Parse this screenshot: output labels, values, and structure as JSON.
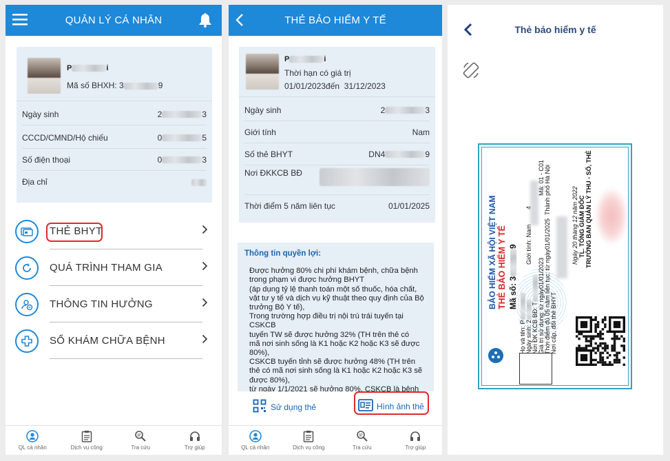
{
  "screen1": {
    "header_title": "QUẢN LÝ CÁ NHÂN",
    "profile": {
      "name_prefix": "P",
      "name_suffix": "i",
      "bhxh_label": "Mã số BHXH: 3",
      "bhxh_end": "9"
    },
    "fields": [
      {
        "label": "Ngày sinh",
        "value_start": "2",
        "value_end": "3"
      },
      {
        "label": "CCCD/CMND/Hộ chiếu",
        "value_start": "0",
        "value_end": "5"
      },
      {
        "label": "Số điện thoại",
        "value_start": "0",
        "value_end": "3"
      },
      {
        "label": "Địa chỉ",
        "value_start": "",
        "value_end": ""
      }
    ],
    "menu": [
      {
        "label": "THẺ BHYT",
        "icon": "card-icon"
      },
      {
        "label": "QUÁ TRÌNH THAM GIA",
        "icon": "refresh-icon"
      },
      {
        "label": "THÔNG TIN HƯỞNG",
        "icon": "user-info-icon"
      },
      {
        "label": "SỔ KHÁM CHỮA BỆNH",
        "icon": "medical-cross-icon"
      }
    ]
  },
  "tabs": [
    {
      "label": "QL cá nhân",
      "icon": "user-circle-icon"
    },
    {
      "label": "Dịch vụ công",
      "icon": "clipboard-icon"
    },
    {
      "label": "Tra cứu",
      "icon": "search-doc-icon"
    },
    {
      "label": "Trợ giúp",
      "icon": "headset-icon"
    }
  ],
  "screen2": {
    "header_title": "THẺ BẢO HIỂM Y TẾ",
    "profile": {
      "name_prefix": "P",
      "name_suffix": "i",
      "validity_label": "Thời hạn có giá trị",
      "validity_from": "01/01/2023đến",
      "validity_to": "31/12/2023"
    },
    "fields": [
      {
        "label": "Ngày sinh",
        "value_start": "2",
        "value_end": "3"
      },
      {
        "label": "Giới tính",
        "value_start": "",
        "value_end": "Nam"
      },
      {
        "label": "Số thẻ BHYT",
        "value_start": "DN4",
        "value_end": "9"
      },
      {
        "label": "Nơi ĐKKCB BĐ",
        "value_start": "",
        "value_end": ""
      },
      {
        "label": "Thời điểm 5 năm liên tục",
        "value_start": "",
        "value_end": "01/01/2025"
      }
    ],
    "benefit_title": "Thông tin quyền lợi:",
    "benefit_lines": [
      "Được hưởng 80% chi phí khám bệnh, chữa bệnh",
      "trong phạm vi được hưởng BHYT",
      "(áp dụng tỷ lệ thanh toán một số thuốc, hóa chất,",
      "vật tư y tế và dịch vụ kỹ thuật theo quy định của Bộ",
      "trưởng Bộ Y tế),",
      "Trong trường hợp điều trị nội trú trái tuyến tại CSKCB",
      "tuyến TW sẽ được hưởng 32% (TH trên thẻ có",
      "mã nơi sinh sống là K1 hoặc K2 hoặc K3 sẽ được",
      "80%),",
      "CSKCB tuyến tỉnh sẽ được hưởng 48% (TH trên",
      "thẻ có mã nơi sinh sống là K1 hoặc K2 hoặc K3 sẽ",
      "được 80%),",
      "từ ngày 1/1/2021 sẽ hưởng 80%. CSKCB là bệnh"
    ],
    "action_use": "Sử dụng thẻ",
    "action_image": "Hình ảnh  thẻ"
  },
  "screen3": {
    "title": "Thẻ bảo hiểm y tế",
    "card": {
      "org": "BẢO HIỂM XÃ HỘI VIỆT NAM",
      "title": "THẺ BẢO HIỂM Y TẾ",
      "code_label": "Mã số: 3",
      "code_end": "9",
      "name_label": "Họ và tên: P",
      "dob_label": "Ngày sinh: 2",
      "gender": "Giới tính: Nam",
      "kcb_label": "Nơi ĐK KCB BĐ: T",
      "validity": "Giá trị sử dụng: từ ngày01/01/2023",
      "five_years": "Thời điểm đủ 05 năm liên tục: từ ngày01/01/2025",
      "issue_place": "Nơi cấp, đổi thẻ BHYT",
      "code_suffix": "Mã: 01 - C01",
      "four": "4",
      "city": "Thành phố Hà Nội",
      "date": "Ngày 20 tháng 12 năm 2022",
      "sign1": "TL. TỔNG GIÁM ĐỐC",
      "sign2": "TRƯỞNG BAN QUẢN LÝ THU - SỔ, THẺ"
    }
  },
  "colors": {
    "primary": "#1e88d9",
    "highlight": "#e0292b",
    "card_border": "#2da4c4",
    "card_red": "#d8262b",
    "card_blue": "#1a56a8"
  }
}
